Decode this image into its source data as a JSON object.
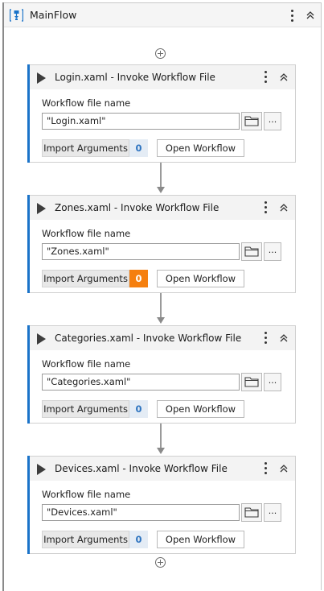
{
  "flow": {
    "title": "MainFlow",
    "icon": "flowchart-icon"
  },
  "cards": [
    {
      "title": "Login.xaml - Invoke Workflow File",
      "field_label": "Workflow file name",
      "file_value": "\"Login.xaml\"",
      "browse_label": "...",
      "import_label": "Import Arguments",
      "import_count": "0",
      "import_count_color": "#2e74c0",
      "open_label": "Open Workflow"
    },
    {
      "title": "Zones.xaml - Invoke Workflow File",
      "field_label": "Workflow file name",
      "file_value": "\"Zones.xaml\"",
      "browse_label": "...",
      "import_label": "Import Arguments",
      "import_count": "0",
      "import_count_color": "#f57f0f",
      "open_label": "Open Workflow"
    },
    {
      "title": "Categories.xaml - Invoke Workflow File",
      "field_label": "Workflow file name",
      "file_value": "\"Categories.xaml\"",
      "browse_label": "...",
      "import_label": "Import Arguments",
      "import_count": "0",
      "import_count_color": "#2e74c0",
      "open_label": "Open Workflow"
    },
    {
      "title": "Devices.xaml - Invoke Workflow File",
      "field_label": "Workflow file name",
      "file_value": "\"Devices.xaml\"",
      "browse_label": "...",
      "import_label": "Import Arguments",
      "import_count": "0",
      "import_count_color": "#2e74c0",
      "open_label": "Open Workflow"
    }
  ],
  "colors": {
    "accent": "#1a73c9",
    "warning": "#f57f0f"
  }
}
